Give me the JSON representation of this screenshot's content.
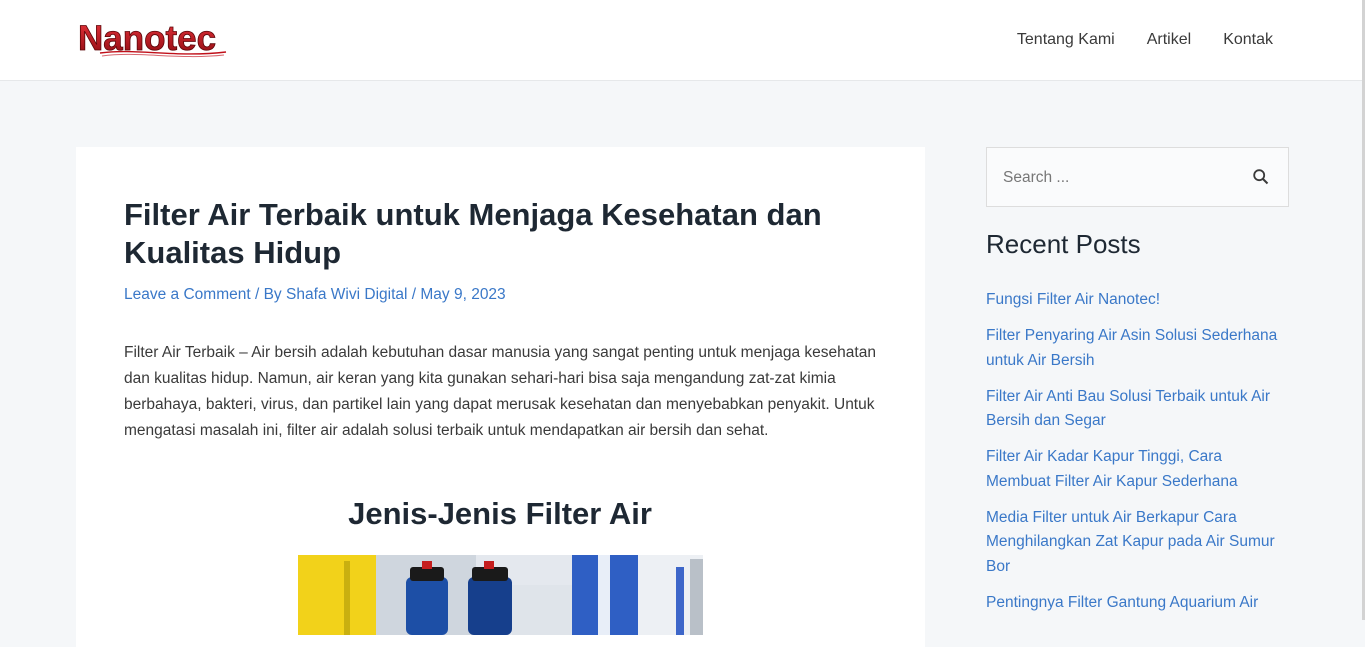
{
  "brand": {
    "logo_text": "Nanotec",
    "accent_color": "#c0101a"
  },
  "nav": {
    "items": [
      "Tentang Kami",
      "Artikel",
      "Kontak"
    ]
  },
  "article": {
    "title": "Filter Air Terbaik untuk Menjaga Kesehatan dan Kualitas Hidup",
    "meta": {
      "comment_link": "Leave a Comment",
      "separator": " / ",
      "by_label": "By ",
      "author": "Shafa Wivi Digital",
      "date": "May 9, 2023"
    },
    "intro": "Filter Air Terbaik – Air bersih adalah kebutuhan dasar manusia yang sangat penting untuk menjaga kesehatan dan kualitas hidup. Namun, air keran yang kita gunakan sehari-hari bisa saja mengandung zat-zat kimia berbahaya, bakteri, virus, dan partikel lain yang dapat merusak kesehatan dan menyebabkan penyakit. Untuk mengatasi masalah ini, filter air adalah solusi terbaik untuk mendapatkan air bersih dan sehat.",
    "section_heading": "Jenis-Jenis Filter Air"
  },
  "sidebar": {
    "search": {
      "placeholder": "Search ...",
      "icon": "search-icon"
    },
    "recent_title": "Recent Posts",
    "recent_posts": [
      "Fungsi Filter Air Nanotec!",
      "Filter Penyaring Air Asin Solusi Sederhana untuk Air Bersih",
      "Filter Air Anti Bau Solusi Terbaik untuk Air Bersih dan Segar",
      "Filter Air Kadar Kapur Tinggi, Cara Membuat Filter Air Kapur Sederhana",
      "Media Filter untuk Air Berkapur Cara Menghilangkan Zat Kapur pada Air Sumur Bor",
      "Pentingnya Filter Gantung Aquarium Air"
    ]
  },
  "colors": {
    "link": "#3a78c8",
    "heading": "#1e2833",
    "page_bg": "#f5f7f9"
  }
}
